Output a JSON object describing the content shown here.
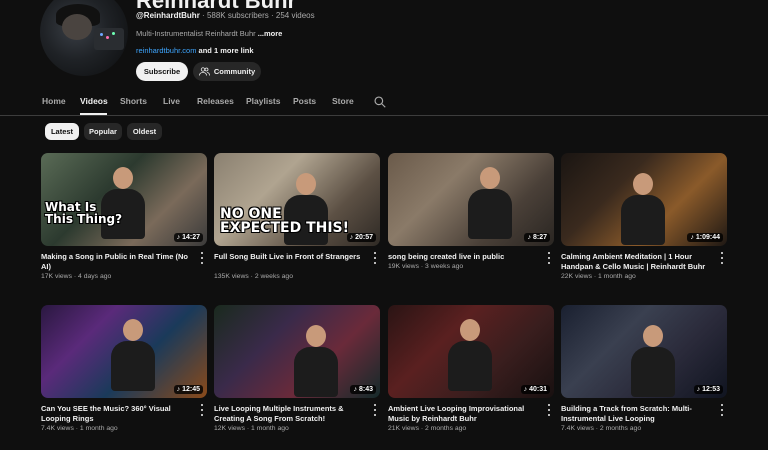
{
  "channel": {
    "name": "Reinhardt Buhr",
    "handle": "@ReinhardtBuhr",
    "subscribers": "588K subscribers",
    "video_count": "254 videos",
    "separator": "·",
    "description": "Multi-Instrumentalist Reinhardt Buhr",
    "more": "...more",
    "link": "reinhardtbuhr.com",
    "link_extra": "and 1 more link",
    "subscribe_label": "Subscribe",
    "community_label": "Community"
  },
  "tabs": [
    {
      "label": "Home"
    },
    {
      "label": "Videos"
    },
    {
      "label": "Shorts"
    },
    {
      "label": "Live"
    },
    {
      "label": "Releases"
    },
    {
      "label": "Playlists"
    },
    {
      "label": "Posts"
    },
    {
      "label": "Store"
    }
  ],
  "active_tab": "Videos",
  "chips": [
    {
      "label": "Latest",
      "selected": true
    },
    {
      "label": "Popular",
      "selected": false
    },
    {
      "label": "Oldest",
      "selected": false
    }
  ],
  "videos": [
    {
      "title": "Making a Song in Public in Real Time (No AI)",
      "views": "17K views",
      "age": "4 days ago",
      "duration": "14:27",
      "overlay": "What Is\nThis Thing?"
    },
    {
      "title": "Full Song Built Live in Front of Strangers",
      "views": "135K views",
      "age": "2 weeks ago",
      "duration": "20:57",
      "overlay": "NO ONE\nEXPECTED THIS!"
    },
    {
      "title": "song being created live in public",
      "views": "19K views",
      "age": "3 weeks ago",
      "duration": "8:27",
      "overlay": ""
    },
    {
      "title": "Calming Ambient Meditation | 1 Hour Handpan & Cello Music | Reinhardt Buhr",
      "views": "22K views",
      "age": "1 month ago",
      "duration": "1:09:44",
      "overlay": ""
    },
    {
      "title": "Can You SEE the Music? 360° Visual Looping Rings",
      "views": "7.4K views",
      "age": "1 month ago",
      "duration": "12:45",
      "overlay": ""
    },
    {
      "title": "Live Looping Multiple Instruments & Creating A Song From Scratch!",
      "views": "12K views",
      "age": "1 month ago",
      "duration": "8:43",
      "overlay": ""
    },
    {
      "title": "Ambient Live Looping Improvisational Music by Reinhardt Buhr",
      "views": "21K views",
      "age": "2 months ago",
      "duration": "40:31",
      "overlay": ""
    },
    {
      "title": "Building a Track from Scratch: Multi-Instrumental Live Looping",
      "views": "7.4K views",
      "age": "2 months ago",
      "duration": "12:53",
      "overlay": ""
    }
  ],
  "icons": {
    "search": "search-icon",
    "community": "people-icon",
    "music_note": "music-note-icon",
    "kebab": "more-vert-icon"
  },
  "colors": {
    "background": "#0f0f0f",
    "link": "#3ea6ff",
    "text_primary": "#f1f1f1",
    "text_secondary": "#aaaaaa"
  }
}
